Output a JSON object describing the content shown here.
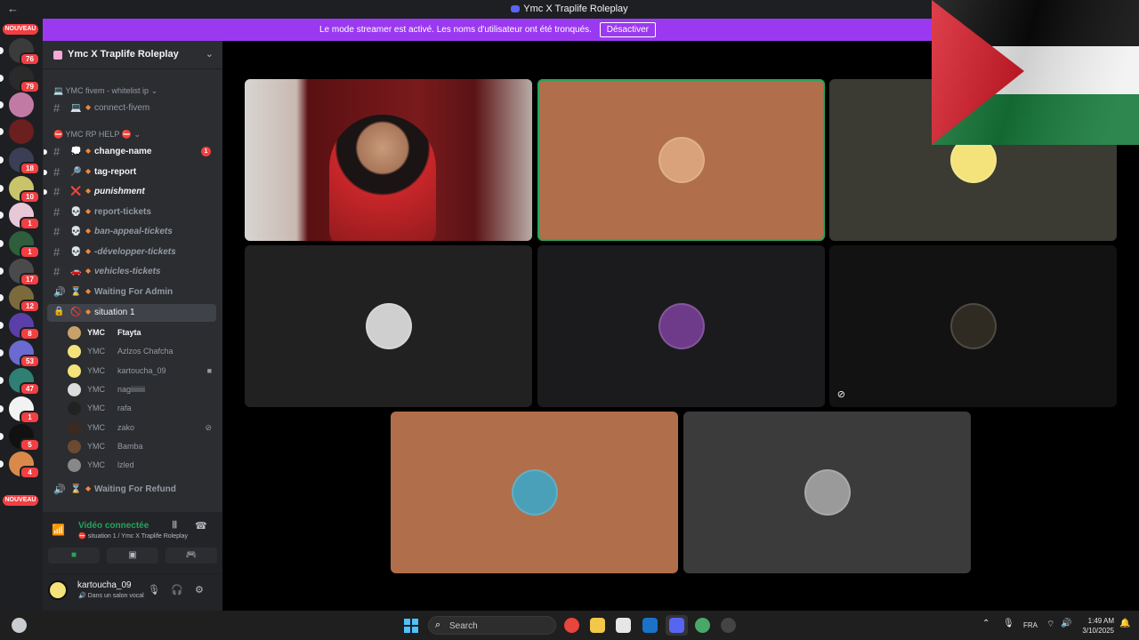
{
  "window": {
    "title": "Ymc X Traplife Roleplay",
    "back_icon": "arrow-left-icon"
  },
  "banner": {
    "text": "Le mode streamer est activé. Les noms d'utilisateur ont été tronqués.",
    "button": "Désactiver"
  },
  "rail": {
    "top_badge": "NOUVEAU",
    "bottom_badge": "NOUVEAU",
    "servers": [
      {
        "badge": "76",
        "color": "#3b3b3b"
      },
      {
        "badge": "79",
        "color": "#2a2a2a"
      },
      {
        "badge": "",
        "color": "#c27aa5"
      },
      {
        "badge": "",
        "color": "#6b1f1f"
      },
      {
        "badge": "18",
        "color": "#3a3f55"
      },
      {
        "badge": "10",
        "color": "#c9c36a"
      },
      {
        "badge": "1",
        "color": "#e8c7d8"
      },
      {
        "badge": "1",
        "color": "#2e5e3c"
      },
      {
        "badge": "17",
        "color": "#4a4a4a"
      },
      {
        "badge": "12",
        "color": "#7b6a3c"
      },
      {
        "badge": "8",
        "color": "#5a3fa8"
      },
      {
        "badge": "53",
        "color": "#6a6ad0"
      },
      {
        "badge": "47",
        "color": "#2f7f72"
      },
      {
        "badge": "1",
        "color": "#f2f2f2"
      },
      {
        "badge": "5",
        "color": "#111111"
      },
      {
        "badge": "4",
        "color": "#d98a4a"
      }
    ]
  },
  "sidebar": {
    "server_name": "Ymc X Traplife Roleplay",
    "categories": [
      {
        "label": "YMC fivem - whitelist ip"
      },
      {
        "label": "YMC RP HELP"
      }
    ],
    "channels": [
      {
        "label": "connect-fivem",
        "emoji": "💻"
      },
      {
        "label": "change-name",
        "emoji": "💭",
        "mention": "1"
      },
      {
        "label": "tag-report",
        "emoji": "🔎"
      },
      {
        "label": "punishment",
        "emoji": "❌"
      },
      {
        "label": "report-tickets",
        "emoji": "💀"
      },
      {
        "label": "ban-appeal-tickets",
        "emoji": "💀"
      },
      {
        "label": "-développer-tickets",
        "emoji": "💀"
      },
      {
        "label": "vehicles-tickets",
        "emoji": "🚗"
      },
      {
        "label": "Waiting For Admin",
        "emoji": "⌛"
      },
      {
        "label": "situation 1",
        "emoji": "🚫"
      },
      {
        "label": "Waiting For Refund",
        "emoji": "⌛"
      }
    ],
    "voice_users": [
      {
        "tag": "YMC",
        "name": "Ftayta",
        "speaking": true,
        "color": "#c8a06a"
      },
      {
        "tag": "YMC",
        "name": "Azlzos Chafcha",
        "color": "#f3e37a"
      },
      {
        "tag": "YMC",
        "name": "kartoucha_09",
        "status_icon": "camera-icon",
        "color": "#f3e37a"
      },
      {
        "tag": "YMC",
        "name": "nagiiiiiiii",
        "color": "#dddddd"
      },
      {
        "tag": "YMC",
        "name": "rafa",
        "color": "#222222"
      },
      {
        "tag": "YMC",
        "name": "zako",
        "status_icon": "mic-off-icon",
        "color": "#3a2a20"
      },
      {
        "tag": "YMC",
        "name": "Bamba",
        "color": "#6b4a30"
      },
      {
        "tag": "YMC",
        "name": "lzled",
        "color": "#888888"
      }
    ]
  },
  "voice_panel": {
    "status": "Vidéo connectée",
    "location": "situation 1 / Ymc X Traplife Roleplay"
  },
  "user_panel": {
    "username": "kartoucha_09",
    "status": "Dans un salon vocal"
  },
  "stage": {
    "tiles": [
      {
        "kind": "camera",
        "bg": "#2a1618"
      },
      {
        "kind": "avatar",
        "bg": "#b06e4a",
        "speaking": true,
        "avatar_color": "#d9a27a"
      },
      {
        "kind": "avatar",
        "bg": "#3b3a33",
        "avatar_color": "#f3e37a"
      },
      {
        "kind": "avatar",
        "bg": "#212121",
        "avatar_color": "#cfcfcf"
      },
      {
        "kind": "avatar",
        "bg": "#1b1b1d",
        "avatar_color": "#6e3a8a"
      },
      {
        "kind": "avatar",
        "bg": "#121212",
        "avatar_color": "#2f2a22",
        "muted": true
      },
      {
        "kind": "avatar",
        "bg": "#b06e4a",
        "avatar_color": "#4aa0b8"
      },
      {
        "kind": "avatar",
        "bg": "#3b3b3b",
        "avatar_color": "#9a9a9a"
      }
    ]
  },
  "taskbar": {
    "search_placeholder": "Search",
    "language": "FRA",
    "time": "1:49 AM",
    "date": "3/10/2025"
  },
  "colors": {
    "banner": "#9b39f1",
    "online": "#23a55a",
    "mention": "#f23f42",
    "sidebar": "#2b2d31",
    "rail": "#1e1f22"
  }
}
